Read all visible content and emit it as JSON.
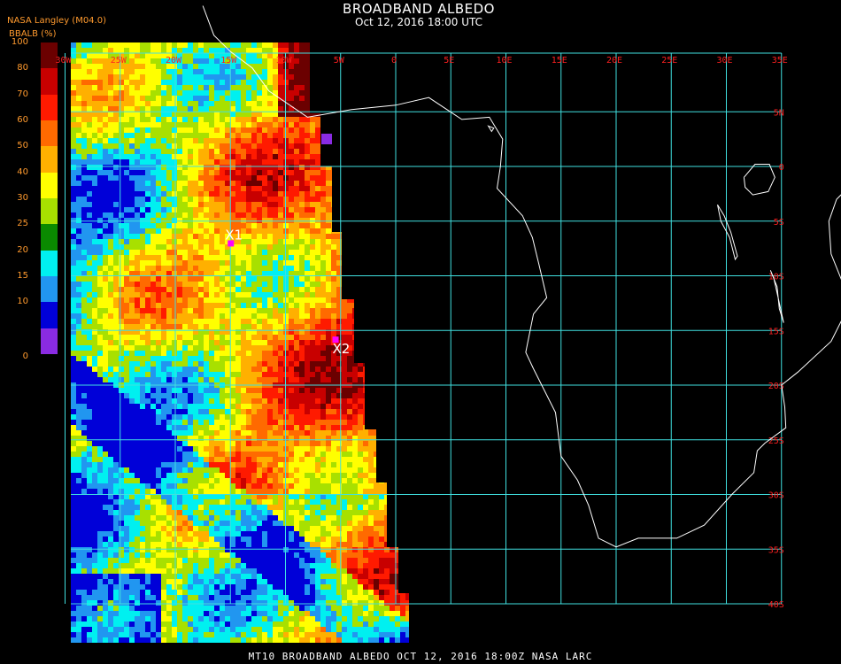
{
  "header": {
    "title": "BROADBAND ALBEDO",
    "subtitle": "Oct 12, 2016 18:00 UTC",
    "source": "NASA Langley (M04.0)",
    "unit": "BBALB (%)"
  },
  "legend": {
    "labels": [
      "100",
      "80",
      "70",
      "60",
      "50",
      "40",
      "30",
      "25",
      "20",
      "15",
      "10",
      "0"
    ],
    "colors": [
      "#6b0000",
      "#c80000",
      "#ff1a00",
      "#ff6a00",
      "#ffb000",
      "#ffff00",
      "#a8e000",
      "#0a8a00",
      "#00f0f0",
      "#2196f0",
      "#0000d8",
      "#8a2be2"
    ]
  },
  "map": {
    "lon_labels": [
      "30W",
      "25W",
      "20W",
      "15W",
      "10W",
      "5W",
      "0",
      "5E",
      "10E",
      "15E",
      "20E",
      "25E",
      "30E",
      "35E"
    ],
    "lat_labels": [
      "5N",
      "0",
      "5S",
      "10S",
      "15S",
      "20S",
      "25S",
      "30S",
      "35S",
      "40S"
    ],
    "grid_color": "#40e0e0",
    "label_color": "#ff2020",
    "markers": [
      {
        "label": "X1",
        "lon": -15,
        "lat": -7
      },
      {
        "label": "X2",
        "lon": -5.5,
        "lat": -15.8
      }
    ]
  },
  "footer": "MT10  BROADBAND ALBEDO   OCT 12, 2016 18:00Z   NASA LARC"
}
